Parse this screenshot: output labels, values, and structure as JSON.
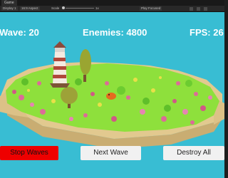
{
  "editor": {
    "tab_label": "Game",
    "display_label": "Display 1",
    "aspect_label": "16:9 Aspect",
    "scale_label": "Scale",
    "scale_value": "1x",
    "play_focused_label": "Play Focused"
  },
  "hud": {
    "wave_label": "Wave: 20",
    "enemies_label": "Enemies: 4800",
    "fps_label": "FPS: 26"
  },
  "buttons": {
    "stop_waves": "Stop Waves",
    "next_wave": "Next Wave",
    "destroy_all": "Destroy All"
  },
  "colors": {
    "sky": "#38bdd3",
    "grass": "#8ee03c",
    "sand": "#e2c98f",
    "stop_button": "#ee0000",
    "button": "#f1f1f1"
  }
}
